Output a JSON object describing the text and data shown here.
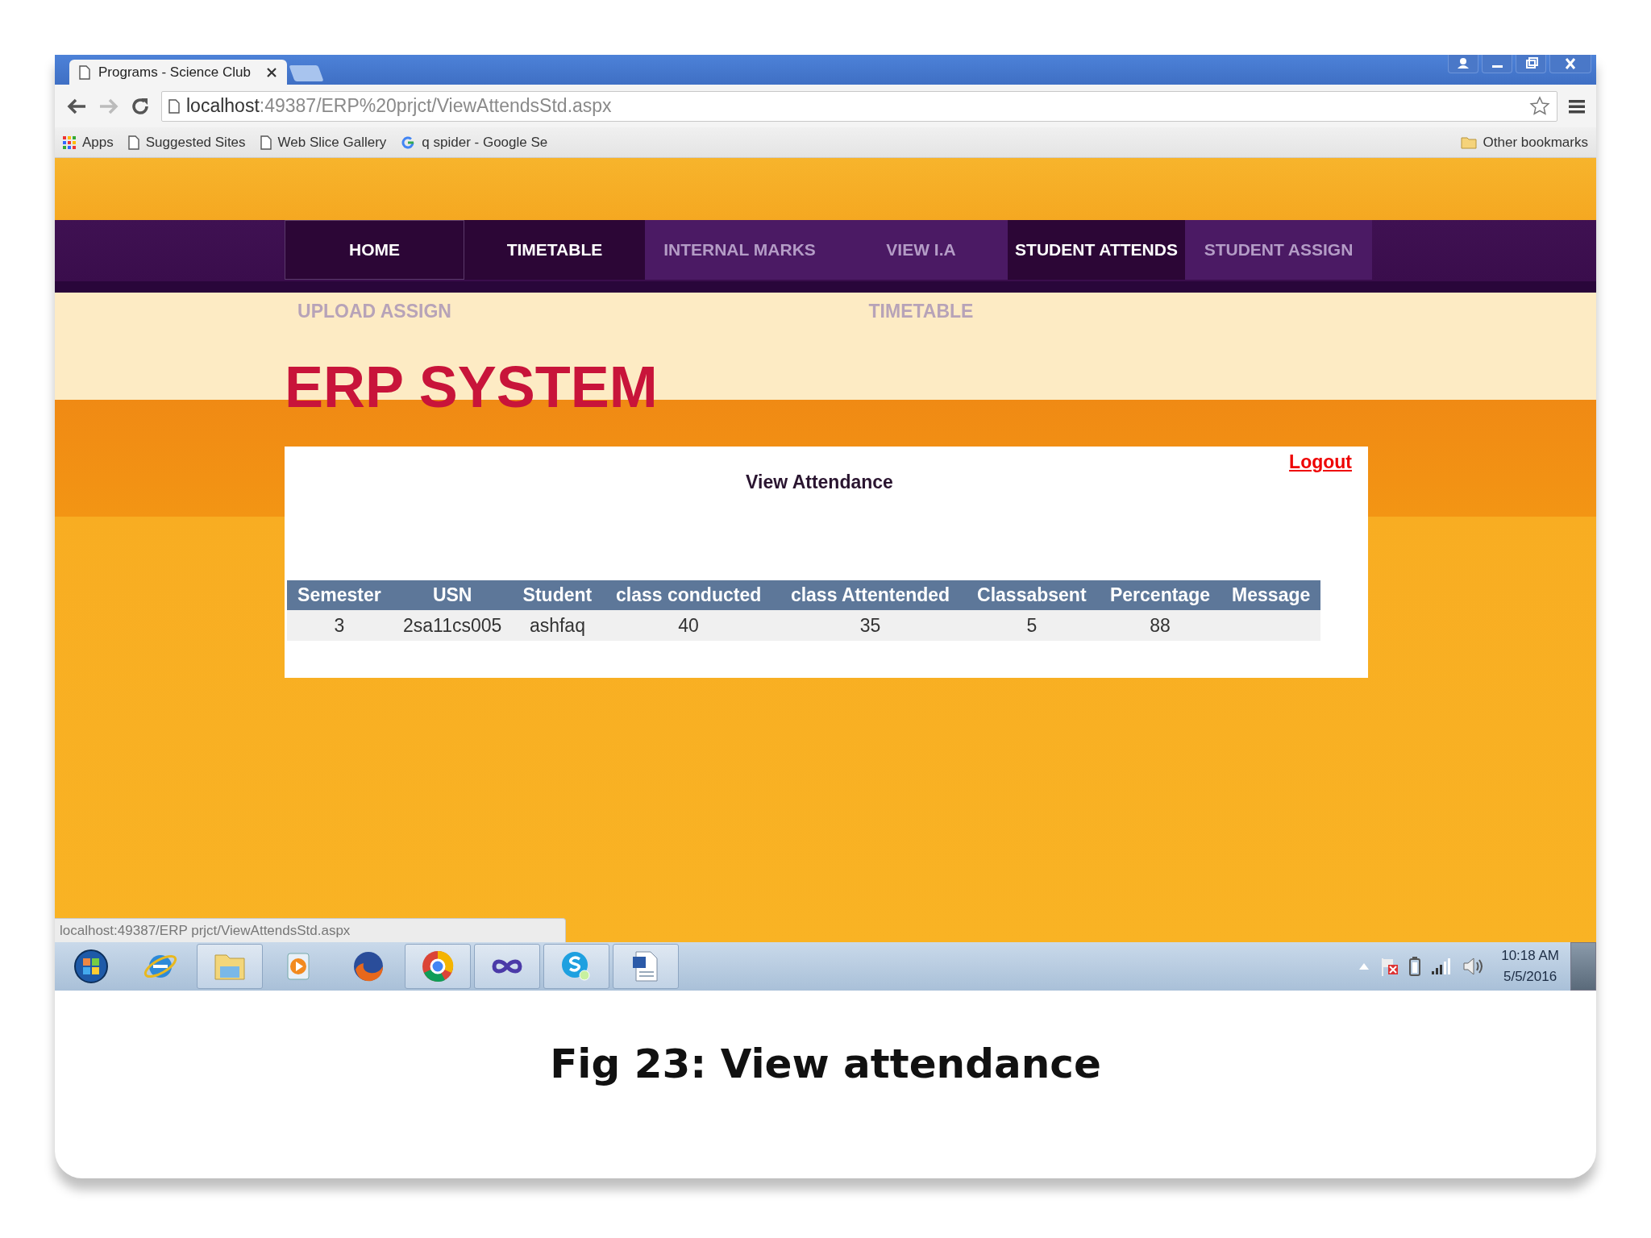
{
  "browser": {
    "tab_title": "Programs - Science Club",
    "url_host": "localhost",
    "url_path": ":49387/ERP%20prjct/ViewAttendsStd.aspx",
    "bookmarks": [
      {
        "kind": "apps",
        "label": "Apps"
      },
      {
        "kind": "page",
        "label": "Suggested Sites"
      },
      {
        "kind": "page",
        "label": "Web Slice Gallery"
      },
      {
        "kind": "google",
        "label": "q spider - Google Se"
      }
    ],
    "other_bookmarks": "Other bookmarks"
  },
  "nav": {
    "items": [
      {
        "label": "HOME",
        "active": true,
        "children": [
          {
            "label": "UPLOAD ASSIGN"
          }
        ]
      },
      {
        "label": "TIMETABLE",
        "active": true
      },
      {
        "label": "INTERNAL MARKS",
        "active": false
      },
      {
        "label": "VIEW I.A",
        "active": false,
        "children": [
          {
            "label": "TIMETABLE"
          }
        ]
      },
      {
        "label": "STUDENT ATTENDS",
        "active": true
      },
      {
        "label": "STUDENT ASSIGN",
        "active": false
      }
    ]
  },
  "site_title": "ERP SYSTEM",
  "panel": {
    "logout": "Logout",
    "heading": "View Attendance",
    "table": {
      "columns": [
        "Semester",
        "USN",
        "Student",
        "class conducted",
        "class Attentended",
        "Classabsent",
        "Percentage",
        "Message"
      ],
      "rows": [
        [
          "3",
          "2sa11cs005",
          "ashfaq",
          "40",
          "35",
          "5",
          "88",
          ""
        ]
      ]
    }
  },
  "status_url": "localhost:49387/ERP prjct/ViewAttendsStd.aspx",
  "taskbar": {
    "buttons": [
      {
        "kind": "start",
        "open": false
      },
      {
        "kind": "globe",
        "open": false
      },
      {
        "kind": "folder",
        "open": true
      },
      {
        "kind": "player",
        "open": false
      },
      {
        "kind": "fox",
        "open": false
      },
      {
        "kind": "wheel",
        "open": true
      },
      {
        "kind": "infinity",
        "open": true
      },
      {
        "kind": "chat",
        "open": true
      },
      {
        "kind": "document",
        "open": true
      }
    ],
    "time": "10:18 AM",
    "date": "5/5/2016"
  },
  "caption": "Fig 23: View attendance"
}
